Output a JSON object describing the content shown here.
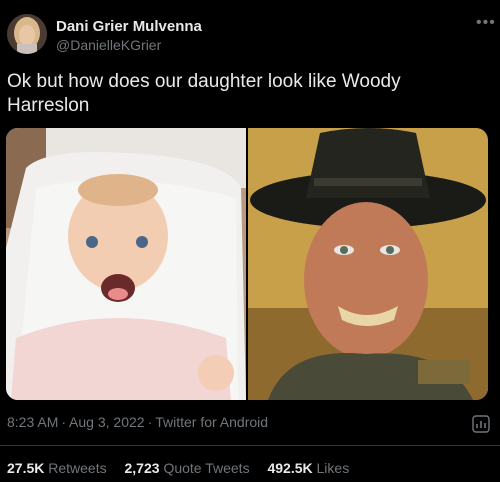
{
  "author": {
    "display_name": "Dani Grier Mulvenna",
    "handle": "@DanielleKGrier"
  },
  "tweet": {
    "text": "Ok but how does our daughter look like Woody Harreslon"
  },
  "media": {
    "left_image": "smiling-baby-photo",
    "right_image": "man-in-cowboy-hat-photo"
  },
  "meta": {
    "time": "8:23 AM",
    "date": "Aug 3, 2022",
    "source": "Twitter for Android",
    "separator": "·"
  },
  "stats": {
    "retweets_count": "27.5K",
    "retweets_label": "Retweets",
    "quotes_count": "2,723",
    "quotes_label": "Quote Tweets",
    "likes_count": "492.5K",
    "likes_label": "Likes"
  },
  "icons": {
    "more": "more-icon",
    "analytics": "analytics-icon"
  },
  "colors": {
    "background": "#000000",
    "primary_text": "#e7e9ea",
    "secondary_text": "#71767b",
    "divider": "#2f3336"
  }
}
